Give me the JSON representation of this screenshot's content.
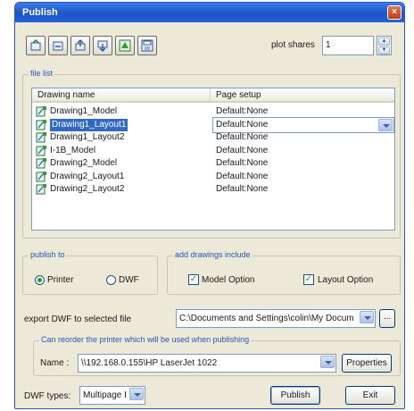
{
  "window": {
    "title": "Publish",
    "close_glyph": "×"
  },
  "toolbar": {
    "buttons": [
      "add-drawing-icon",
      "remove-drawing-icon",
      "move-up-icon",
      "move-down-icon",
      "load-list-icon",
      "save-list-icon"
    ],
    "plot_shares_label": "plot shares",
    "plot_shares_value": "1"
  },
  "file_list": {
    "group_label": "file list",
    "columns": [
      "Drawing name",
      "Page setup"
    ],
    "rows": [
      {
        "name": "Drawing1_Model",
        "setup": "Default:None"
      },
      {
        "name": "Drawing1_Layout1",
        "setup": "Default:None",
        "selected": true
      },
      {
        "name": "Drawing1_Layout2",
        "setup": "Default:None"
      },
      {
        "name": "I-1B_Model",
        "setup": "Default:None"
      },
      {
        "name": "Drawing2_Model",
        "setup": "Default:None"
      },
      {
        "name": "Drawing2_Layout1",
        "setup": "Default:None"
      },
      {
        "name": "Drawing2_Layout2",
        "setup": "Default:None"
      }
    ]
  },
  "publish_to": {
    "group_label": "publish to",
    "options": [
      "Printer",
      "DWF"
    ],
    "selected": "Printer"
  },
  "add_drawings": {
    "group_label": "add drawings include",
    "model_option": "Model Option",
    "layout_option": "Layout Option"
  },
  "export": {
    "label": "export DWF to selected file",
    "path": "C:\\Documents and Settings\\colin\\My Docum",
    "browse_label": "..."
  },
  "printer": {
    "group_label": "Can reorder the printer which will be used when publishing",
    "name_label": "Name :",
    "name_value": "\\\\192.168.0.155\\HP LaserJet 1022",
    "properties_label": "Properties"
  },
  "dwf": {
    "label": "DWF types:",
    "value": "Multipage I"
  },
  "footer": {
    "publish_label": "Publish",
    "exit_label": "Exit"
  },
  "colors": {
    "titlebar": "#1d55c7",
    "selection": "#316ac5",
    "group_title": "#2b53b8",
    "window_bg": "#ece9d8"
  }
}
